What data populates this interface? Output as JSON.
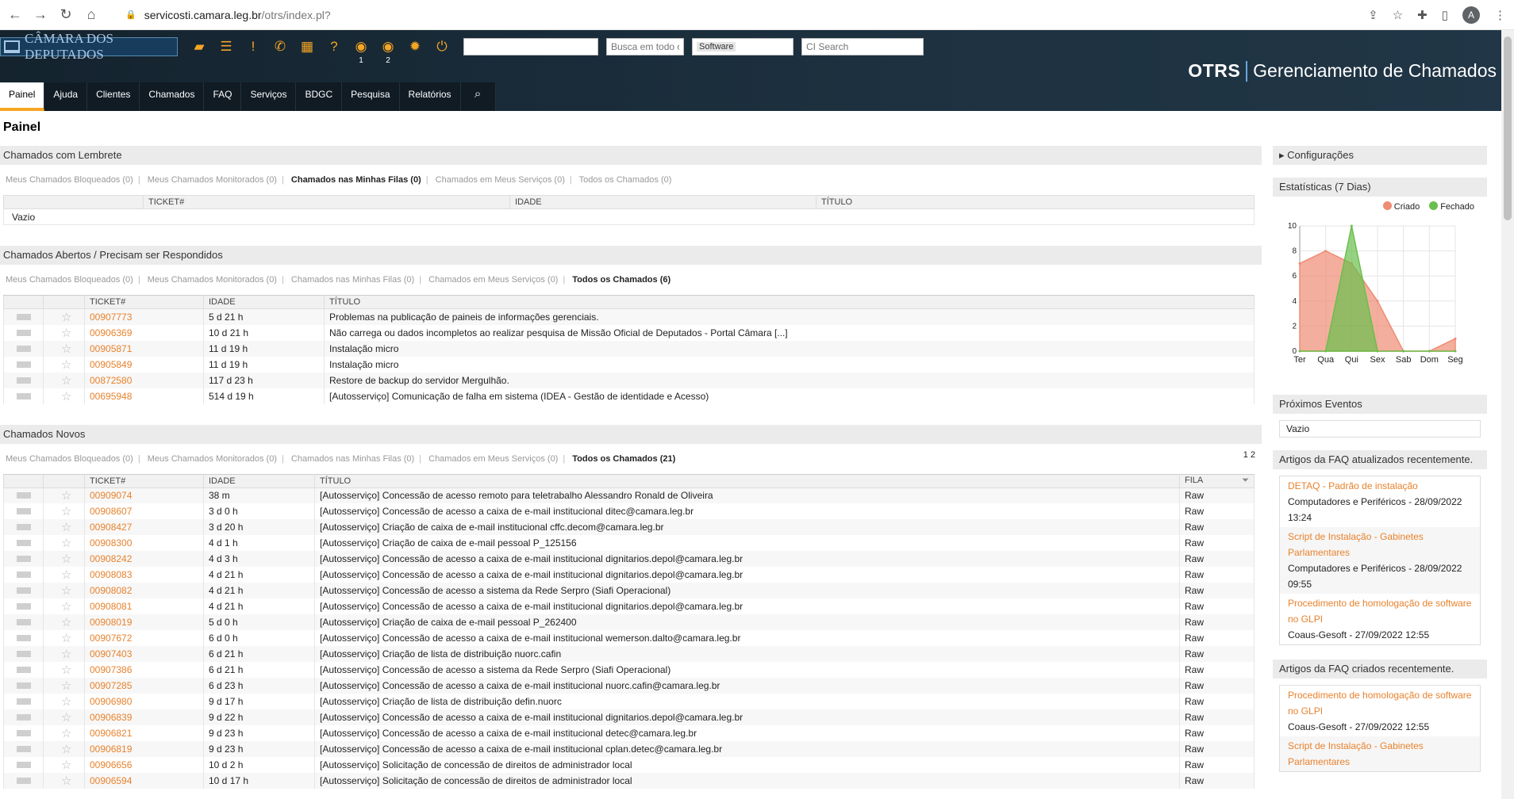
{
  "browser": {
    "url_host": "servicosti.camara.leg.br",
    "url_path": "/otrs/index.pl?"
  },
  "header": {
    "logo": "CÂMARA DOS DEPUTADOS",
    "toolbar_counts": [
      "1",
      "2"
    ],
    "search_busca": "Busca em todo o",
    "search_software": "Software",
    "search_ci": "CI Search",
    "brand_otrs": "OTRS",
    "brand_sub": "Gerenciamento de Chamados"
  },
  "nav": [
    "Painel",
    "Ajuda",
    "Clientes",
    "Chamados",
    "FAQ",
    "Serviços",
    "BDGC",
    "Pesquisa",
    "Relatórios"
  ],
  "page_title": "Painel",
  "columns": {
    "ticket": "TICKET#",
    "idade": "IDADE",
    "titulo": "TÍTULO",
    "fila": "FILA"
  },
  "widget1": {
    "title": "Chamados com Lembrete",
    "filters": [
      "Meus Chamados Bloqueados (0)",
      "Meus Chamados Monitorados (0)",
      "Chamados nas Minhas Filas (0)",
      "Chamados em Meus Serviços (0)",
      "Todos os Chamados (0)"
    ],
    "empty": "Vazio"
  },
  "widget2": {
    "title": "Chamados Abertos / Precisam ser Respondidos",
    "filters": [
      "Meus Chamados Bloqueados (0)",
      "Meus Chamados Monitorados (0)",
      "Chamados nas Minhas Filas (0)",
      "Chamados em Meus Serviços (0)",
      "Todos os Chamados (6)"
    ],
    "rows": [
      [
        "00907773",
        "5 d 21 h",
        "Problemas na publicação de paineis de informações gerenciais."
      ],
      [
        "00906369",
        "10 d 21 h",
        "Não carrega ou dados incompletos ao realizar pesquisa de Missão Oficial de Deputados - Portal Câmara [...]"
      ],
      [
        "00905871",
        "11 d 19 h",
        "Instalação micro"
      ],
      [
        "00905849",
        "11 d 19 h",
        "Instalação micro"
      ],
      [
        "00872580",
        "117 d 23 h",
        "Restore de backup do servidor Mergulhão."
      ],
      [
        "00695948",
        "514 d 19 h",
        "[Autosserviço] Comunicação de falha em sistema (IDEA - Gestão de identidade e Acesso)"
      ]
    ]
  },
  "widget3": {
    "title": "Chamados Novos",
    "pager": "1 2",
    "filters": [
      "Meus Chamados Bloqueados (0)",
      "Meus Chamados Monitorados (0)",
      "Chamados nas Minhas Filas (0)",
      "Chamados em Meus Serviços (0)",
      "Todos os Chamados (21)"
    ],
    "rows": [
      [
        "00909074",
        "38 m",
        "[Autosserviço] Concessão de acesso remoto para teletrabalho Alessandro Ronald de Oliveira",
        "Raw"
      ],
      [
        "00908607",
        "3 d 0 h",
        "[Autosserviço] Concessão de acesso a caixa de e-mail institucional ditec@camara.leg.br",
        "Raw"
      ],
      [
        "00908427",
        "3 d 20 h",
        "[Autosserviço] Criação de caixa de e-mail institucional cffc.decom@camara.leg.br",
        "Raw"
      ],
      [
        "00908300",
        "4 d 1 h",
        "[Autosserviço] Criação de caixa de e-mail pessoal P_125156",
        "Raw"
      ],
      [
        "00908242",
        "4 d 3 h",
        "[Autosserviço] Concessão de acesso a caixa de e-mail institucional dignitarios.depol@camara.leg.br",
        "Raw"
      ],
      [
        "00908083",
        "4 d 21 h",
        "[Autosserviço] Concessão de acesso a caixa de e-mail institucional dignitarios.depol@camara.leg.br",
        "Raw"
      ],
      [
        "00908082",
        "4 d 21 h",
        "[Autosserviço] Concessão de acesso a sistema da Rede Serpro (Siafi Operacional)",
        "Raw"
      ],
      [
        "00908081",
        "4 d 21 h",
        "[Autosserviço] Concessão de acesso a caixa de e-mail institucional dignitarios.depol@camara.leg.br",
        "Raw"
      ],
      [
        "00908019",
        "5 d 0 h",
        "[Autosserviço] Criação de caixa de e-mail pessoal P_262400",
        "Raw"
      ],
      [
        "00907672",
        "6 d 0 h",
        "[Autosserviço] Concessão de acesso a caixa de e-mail institucional wemerson.dalto@camara.leg.br",
        "Raw"
      ],
      [
        "00907403",
        "6 d 21 h",
        "[Autosserviço] Criação de lista de distribuição nuorc.cafin",
        "Raw"
      ],
      [
        "00907386",
        "6 d 21 h",
        "[Autosserviço] Concessão de acesso a sistema da Rede Serpro (Siafi Operacional)",
        "Raw"
      ],
      [
        "00907285",
        "6 d 23 h",
        "[Autosserviço] Concessão de acesso a caixa de e-mail institucional nuorc.cafin@camara.leg.br",
        "Raw"
      ],
      [
        "00906980",
        "9 d 17 h",
        "[Autosserviço] Criação de lista de distribuição defin.nuorc",
        "Raw"
      ],
      [
        "00906839",
        "9 d 22 h",
        "[Autosserviço] Concessão de acesso a caixa de e-mail institucional dignitarios.depol@camara.leg.br",
        "Raw"
      ],
      [
        "00906821",
        "9 d 23 h",
        "[Autosserviço] Concessão de acesso a caixa de e-mail institucional detec@camara.leg.br",
        "Raw"
      ],
      [
        "00906819",
        "9 d 23 h",
        "[Autosserviço] Concessão de acesso a caixa de e-mail institucional cplan.detec@camara.leg.br",
        "Raw"
      ],
      [
        "00906656",
        "10 d 2 h",
        "[Autosserviço] Solicitação de concessão de direitos de administrador local",
        "Raw"
      ],
      [
        "00906594",
        "10 d 17 h",
        "[Autosserviço] Solicitação de concessão de direitos de administrador local",
        "Raw"
      ]
    ]
  },
  "sidebar": {
    "config": "Configurações",
    "stats_title": "Estatísticas (7 Dias)",
    "events_title": "Próximos Eventos",
    "events_empty": "Vazio",
    "faq_updated_title": "Artigos da FAQ atualizados recentemente.",
    "faq_updated": [
      {
        "title": "DETAQ - Padrão de instalação",
        "meta": "Computadores e Periféricos - 28/09/2022 13:24"
      },
      {
        "title": "Script de Instalação - Gabinetes Parlamentares",
        "meta": "Computadores e Periféricos - 28/09/2022 09:55"
      },
      {
        "title": "Procedimento de homologação de software no GLPI",
        "meta": "Coaus-Gesoft - 27/09/2022 12:55"
      }
    ],
    "faq_created_title": "Artigos da FAQ criados recentemente.",
    "faq_created": [
      {
        "title": "Procedimento de homologação de software no GLPI",
        "meta": "Coaus-Gesoft - 27/09/2022 12:55"
      },
      {
        "title": "Script de Instalação - Gabinetes Parlamentares",
        "meta": ""
      }
    ]
  },
  "chart_data": {
    "type": "area",
    "categories": [
      "Ter",
      "Qua",
      "Qui",
      "Sex",
      "Sab",
      "Dom",
      "Seg"
    ],
    "series": [
      {
        "name": "Criado",
        "color": "#ef8c74",
        "values": [
          7,
          8,
          7,
          4,
          0,
          0,
          1
        ]
      },
      {
        "name": "Fechado",
        "color": "#6abf4b",
        "values": [
          0,
          0,
          10,
          0,
          0,
          0,
          0
        ]
      }
    ],
    "ylim": [
      0,
      10
    ],
    "yticks": [
      0,
      2,
      4,
      6,
      8,
      10
    ],
    "legend": "top-right",
    "grid": true
  }
}
